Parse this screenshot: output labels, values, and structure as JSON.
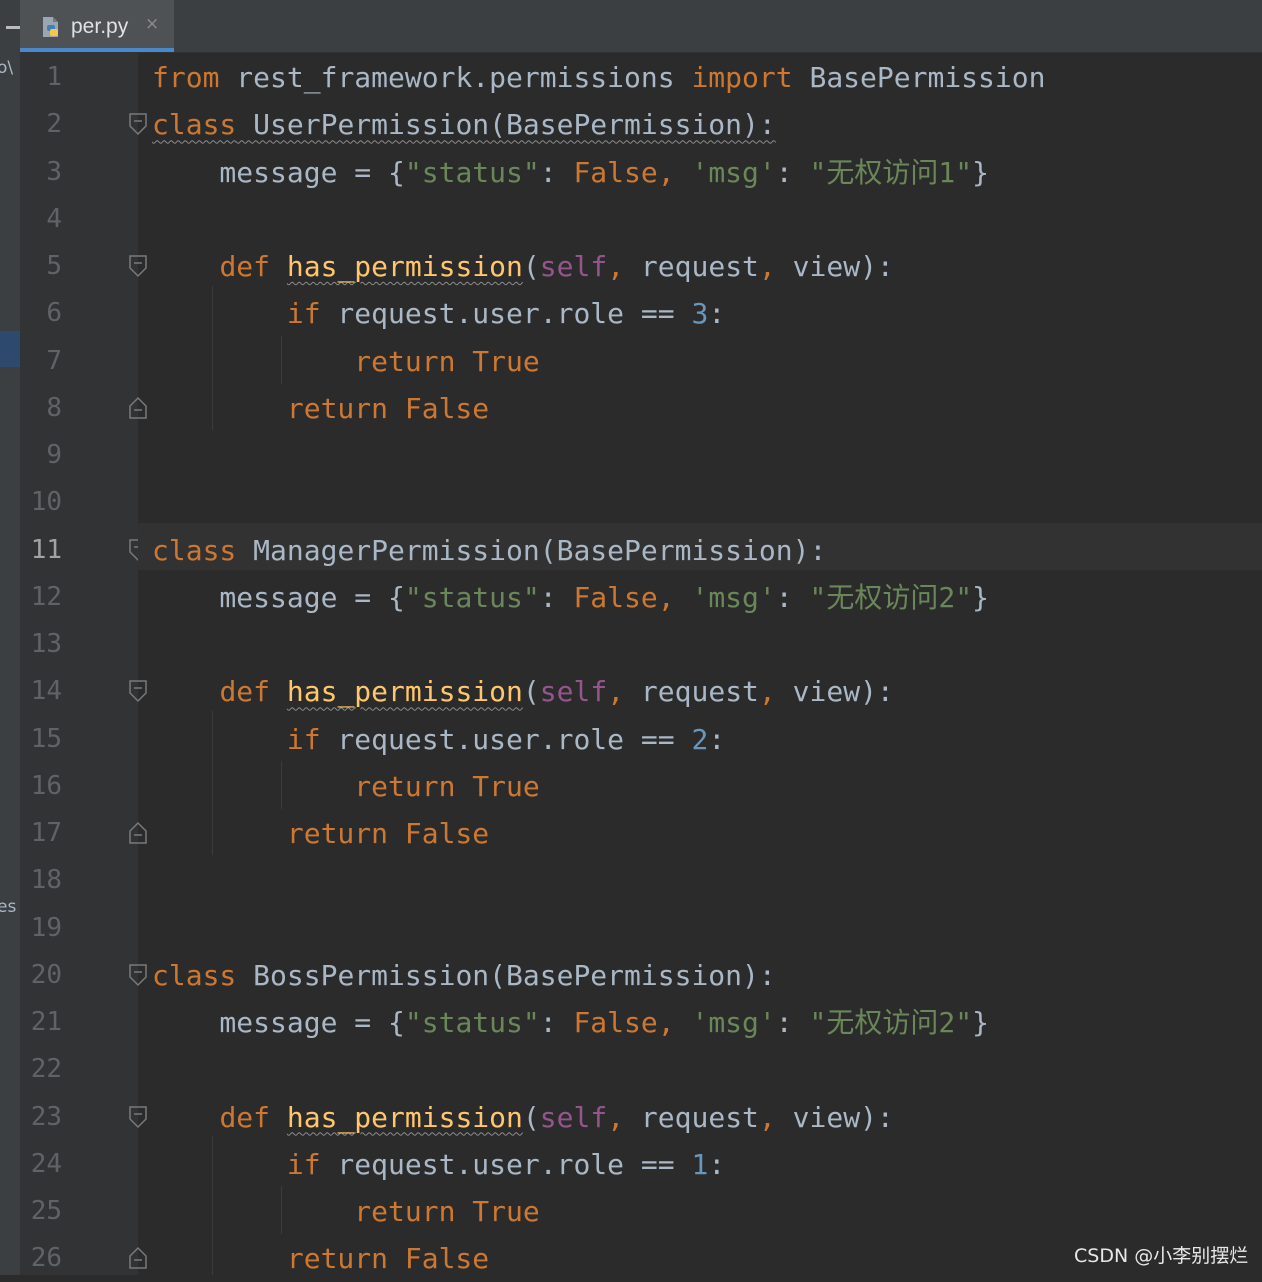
{
  "left_panel": {
    "fragments": [
      {
        "text": "o\\"
      },
      {
        "text": "es"
      }
    ]
  },
  "tab": {
    "filename": "per.py",
    "close_glyph": "×",
    "icon": "python-file-icon"
  },
  "editor": {
    "current_line": 11,
    "colors": {
      "keyword": "#cc7832",
      "string": "#6a8759",
      "number": "#6897bb",
      "self": "#94558d",
      "function": "#ffc66d",
      "text": "#a9b7c6",
      "background": "#2b2b2b",
      "gutter": "#313335"
    },
    "lines": [
      {
        "number": "1",
        "segments": [
          {
            "t": "from",
            "c": "kw"
          },
          {
            "t": " rest_framework.permissions ",
            "c": "plain"
          },
          {
            "t": "import",
            "c": "kw"
          },
          {
            "t": " BasePermission",
            "c": "plain"
          }
        ]
      },
      {
        "number": "2",
        "fold": "open",
        "segments": [
          {
            "t": "class",
            "c": "kw wavy"
          },
          {
            "t": " UserPermission(BasePermission):",
            "c": "plain wavy"
          }
        ]
      },
      {
        "number": "3",
        "segments": [
          {
            "t": "    message = {",
            "c": "plain"
          },
          {
            "t": "\"status\"",
            "c": "str"
          },
          {
            "t": ": ",
            "c": "plain"
          },
          {
            "t": "False",
            "c": "kw"
          },
          {
            "t": ", ",
            "c": "kw"
          },
          {
            "t": "'msg'",
            "c": "str"
          },
          {
            "t": ": ",
            "c": "plain"
          },
          {
            "t": "\"无权访问1\"",
            "c": "str"
          },
          {
            "t": "}",
            "c": "plain"
          }
        ]
      },
      {
        "number": "4",
        "segments": []
      },
      {
        "number": "5",
        "fold": "open",
        "segments": [
          {
            "t": "    ",
            "c": "plain"
          },
          {
            "t": "def",
            "c": "kw"
          },
          {
            "t": " ",
            "c": "plain"
          },
          {
            "t": "has_permission",
            "c": "fn wavy"
          },
          {
            "t": "(",
            "c": "plain"
          },
          {
            "t": "self",
            "c": "self"
          },
          {
            "t": ", ",
            "c": "kw"
          },
          {
            "t": "request",
            "c": "plain"
          },
          {
            "t": ", ",
            "c": "kw"
          },
          {
            "t": "view):",
            "c": "plain"
          }
        ]
      },
      {
        "number": "6",
        "segments": [
          {
            "t": "        ",
            "c": "plain"
          },
          {
            "t": "if",
            "c": "kw"
          },
          {
            "t": " request.user.role == ",
            "c": "plain"
          },
          {
            "t": "3",
            "c": "num"
          },
          {
            "t": ":",
            "c": "plain"
          }
        ]
      },
      {
        "number": "7",
        "segments": [
          {
            "t": "            ",
            "c": "plain"
          },
          {
            "t": "return True",
            "c": "kw"
          }
        ]
      },
      {
        "number": "8",
        "fold": "close",
        "segments": [
          {
            "t": "        ",
            "c": "plain"
          },
          {
            "t": "return False",
            "c": "kw"
          }
        ]
      },
      {
        "number": "9",
        "segments": []
      },
      {
        "number": "10",
        "segments": []
      },
      {
        "number": "11",
        "fold": "open",
        "segments": [
          {
            "t": "class",
            "c": "kw"
          },
          {
            "t": " ManagerPermission(BasePermission):",
            "c": "plain"
          }
        ]
      },
      {
        "number": "12",
        "segments": [
          {
            "t": "    message = {",
            "c": "plain"
          },
          {
            "t": "\"status\"",
            "c": "str"
          },
          {
            "t": ": ",
            "c": "plain"
          },
          {
            "t": "False",
            "c": "kw"
          },
          {
            "t": ", ",
            "c": "kw"
          },
          {
            "t": "'msg'",
            "c": "str"
          },
          {
            "t": ": ",
            "c": "plain"
          },
          {
            "t": "\"无权访问2\"",
            "c": "str"
          },
          {
            "t": "}",
            "c": "plain"
          }
        ]
      },
      {
        "number": "13",
        "segments": []
      },
      {
        "number": "14",
        "fold": "open",
        "segments": [
          {
            "t": "    ",
            "c": "plain"
          },
          {
            "t": "def",
            "c": "kw"
          },
          {
            "t": " ",
            "c": "plain"
          },
          {
            "t": "has_permission",
            "c": "fn wavy"
          },
          {
            "t": "(",
            "c": "plain"
          },
          {
            "t": "self",
            "c": "self"
          },
          {
            "t": ", ",
            "c": "kw"
          },
          {
            "t": "request",
            "c": "plain"
          },
          {
            "t": ", ",
            "c": "kw"
          },
          {
            "t": "view):",
            "c": "plain"
          }
        ]
      },
      {
        "number": "15",
        "segments": [
          {
            "t": "        ",
            "c": "plain"
          },
          {
            "t": "if",
            "c": "kw"
          },
          {
            "t": " request.user.role == ",
            "c": "plain"
          },
          {
            "t": "2",
            "c": "num"
          },
          {
            "t": ":",
            "c": "plain"
          }
        ]
      },
      {
        "number": "16",
        "segments": [
          {
            "t": "            ",
            "c": "plain"
          },
          {
            "t": "return True",
            "c": "kw"
          }
        ]
      },
      {
        "number": "17",
        "fold": "close",
        "segments": [
          {
            "t": "        ",
            "c": "plain"
          },
          {
            "t": "return False",
            "c": "kw"
          }
        ]
      },
      {
        "number": "18",
        "segments": []
      },
      {
        "number": "19",
        "segments": []
      },
      {
        "number": "20",
        "fold": "open",
        "segments": [
          {
            "t": "class",
            "c": "kw"
          },
          {
            "t": " BossPermission(BasePermission):",
            "c": "plain"
          }
        ]
      },
      {
        "number": "21",
        "segments": [
          {
            "t": "    message = {",
            "c": "plain"
          },
          {
            "t": "\"status\"",
            "c": "str"
          },
          {
            "t": ": ",
            "c": "plain"
          },
          {
            "t": "False",
            "c": "kw"
          },
          {
            "t": ", ",
            "c": "kw"
          },
          {
            "t": "'msg'",
            "c": "str"
          },
          {
            "t": ": ",
            "c": "plain"
          },
          {
            "t": "\"无权访问2\"",
            "c": "str"
          },
          {
            "t": "}",
            "c": "plain"
          }
        ]
      },
      {
        "number": "22",
        "segments": []
      },
      {
        "number": "23",
        "fold": "open",
        "segments": [
          {
            "t": "    ",
            "c": "plain"
          },
          {
            "t": "def",
            "c": "kw"
          },
          {
            "t": " ",
            "c": "plain"
          },
          {
            "t": "has_permission",
            "c": "fn wavy"
          },
          {
            "t": "(",
            "c": "plain"
          },
          {
            "t": "self",
            "c": "self"
          },
          {
            "t": ", ",
            "c": "kw"
          },
          {
            "t": "request",
            "c": "plain"
          },
          {
            "t": ", ",
            "c": "kw"
          },
          {
            "t": "view):",
            "c": "plain"
          }
        ]
      },
      {
        "number": "24",
        "segments": [
          {
            "t": "        ",
            "c": "plain"
          },
          {
            "t": "if",
            "c": "kw"
          },
          {
            "t": " request.user.role == ",
            "c": "plain"
          },
          {
            "t": "1",
            "c": "num"
          },
          {
            "t": ":",
            "c": "plain"
          }
        ]
      },
      {
        "number": "25",
        "segments": [
          {
            "t": "            ",
            "c": "plain"
          },
          {
            "t": "return True",
            "c": "kw"
          }
        ]
      },
      {
        "number": "26",
        "fold": "close",
        "segments": [
          {
            "t": "        ",
            "c": "plain"
          },
          {
            "t": "return False",
            "c": "kw"
          }
        ]
      }
    ]
  },
  "watermark": {
    "text": "CSDN @小李别摆烂"
  }
}
